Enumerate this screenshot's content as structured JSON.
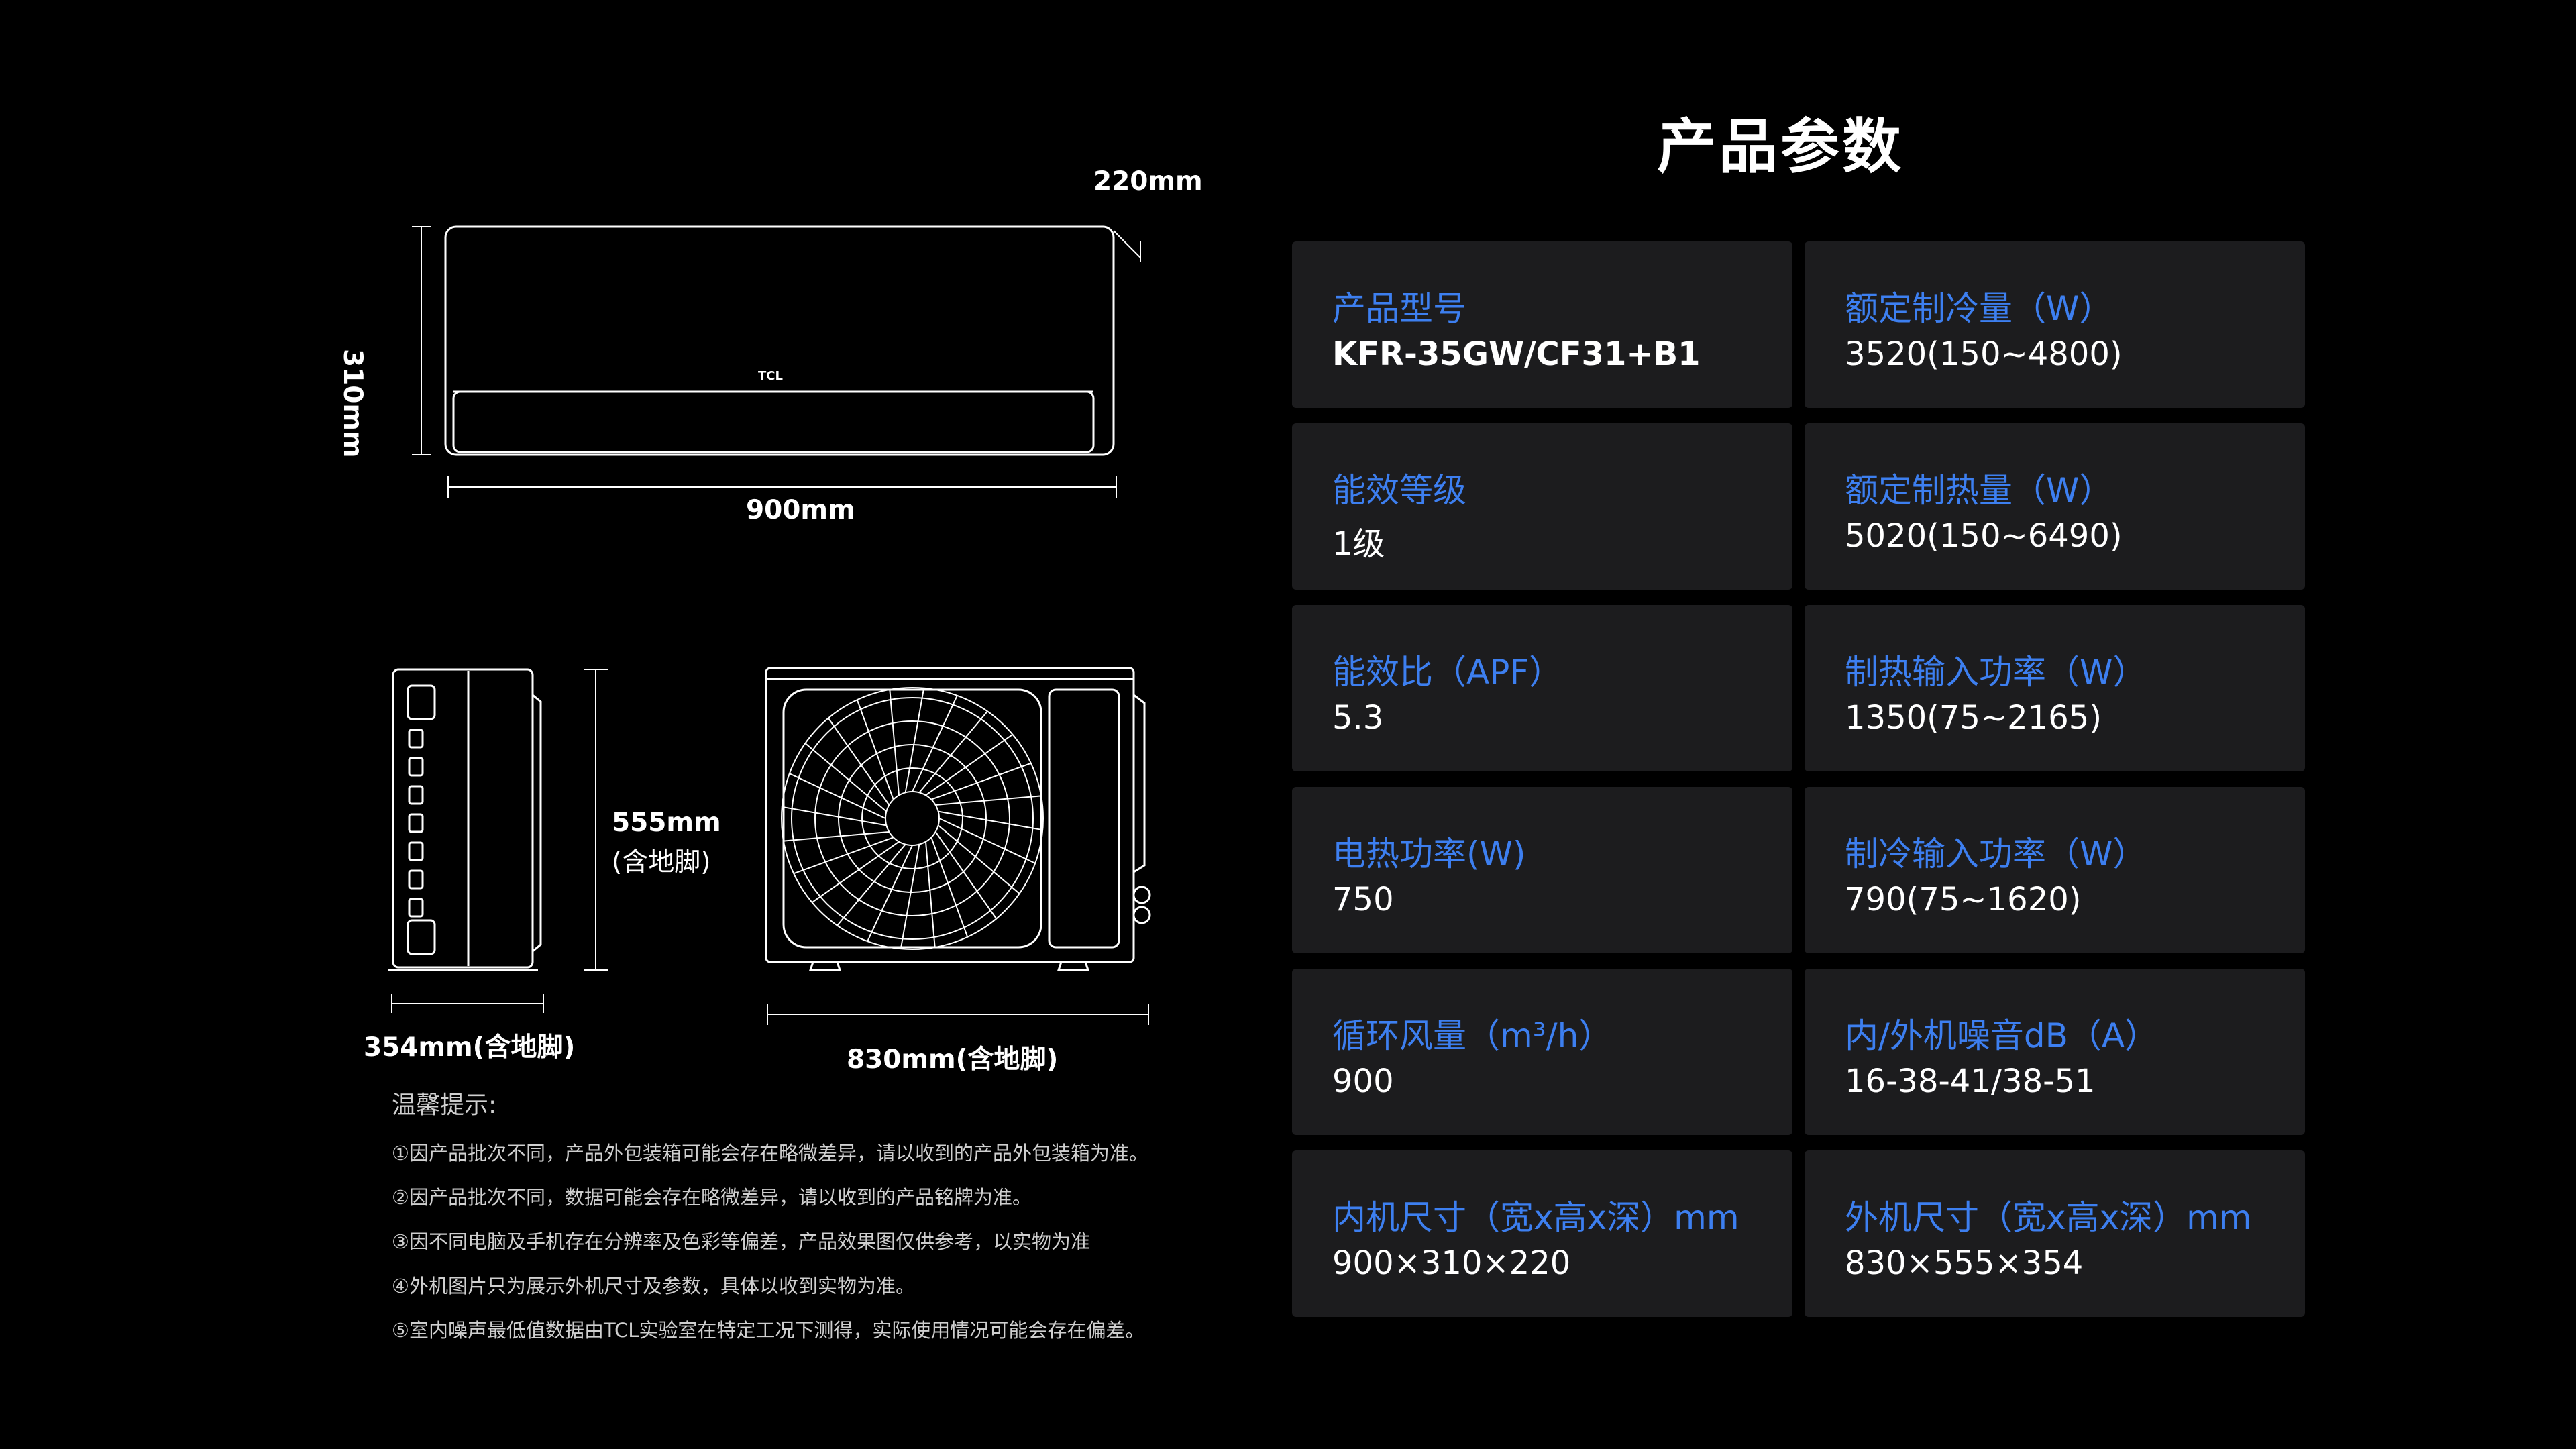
{
  "title": "产品参数",
  "diagram": {
    "indoor_depth": "220mm",
    "indoor_height": "310mm",
    "indoor_width": "900mm",
    "indoor_logo": "TCL",
    "outdoor_height_line1": "555mm",
    "outdoor_height_line2": "(含地脚)",
    "outdoor_depth": "354mm(含地脚)",
    "outdoor_width": "830mm(含地脚)"
  },
  "notes": {
    "title": "温馨提示:",
    "items": [
      "①因产品批次不同，产品外包装箱可能会存在略微差异，请以收到的产品外包装箱为准。",
      "②因产品批次不同，数据可能会存在略微差异，请以收到的产品铭牌为准。",
      "③因不同电脑及手机存在分辨率及色彩等偏差，产品效果图仅供参考，以实物为准",
      "④外机图片只为展示外机尺寸及参数，具体以收到实物为准。",
      "⑤室内噪声最低值数据由TCL实验室在特定工况下测得，实际使用情况可能会存在偏差。"
    ]
  },
  "specs": [
    {
      "label": "产品型号",
      "value": "KFR-35GW/CF31+B1"
    },
    {
      "label": "额定制冷量（W）",
      "value": "3520(150~4800)"
    },
    {
      "label": "能效等级",
      "value": "1级"
    },
    {
      "label": "额定制热量（W）",
      "value": "5020(150~6490)"
    },
    {
      "label": "能效比（APF）",
      "value": "5.3"
    },
    {
      "label": "制热输入功率（W）",
      "value": "1350(75~2165)"
    },
    {
      "label": "电热功率(W)",
      "value": "750"
    },
    {
      "label": "制冷输入功率（W）",
      "value": "790(75~1620)"
    },
    {
      "label": "循环风量（m³/h）",
      "value": "900"
    },
    {
      "label": "内/外机噪音dB（A）",
      "value": "16-38-41/38-51"
    },
    {
      "label": "内机尺寸（宽x高x深）mm",
      "value": "900×310×220"
    },
    {
      "label": "外机尺寸（宽x高x深）mm",
      "value": "830×555×354"
    }
  ],
  "colors": {
    "background": "#000000",
    "card": "#1c1c1e",
    "label_blue": "#3d7ff0",
    "value_white": "#ffffff"
  }
}
